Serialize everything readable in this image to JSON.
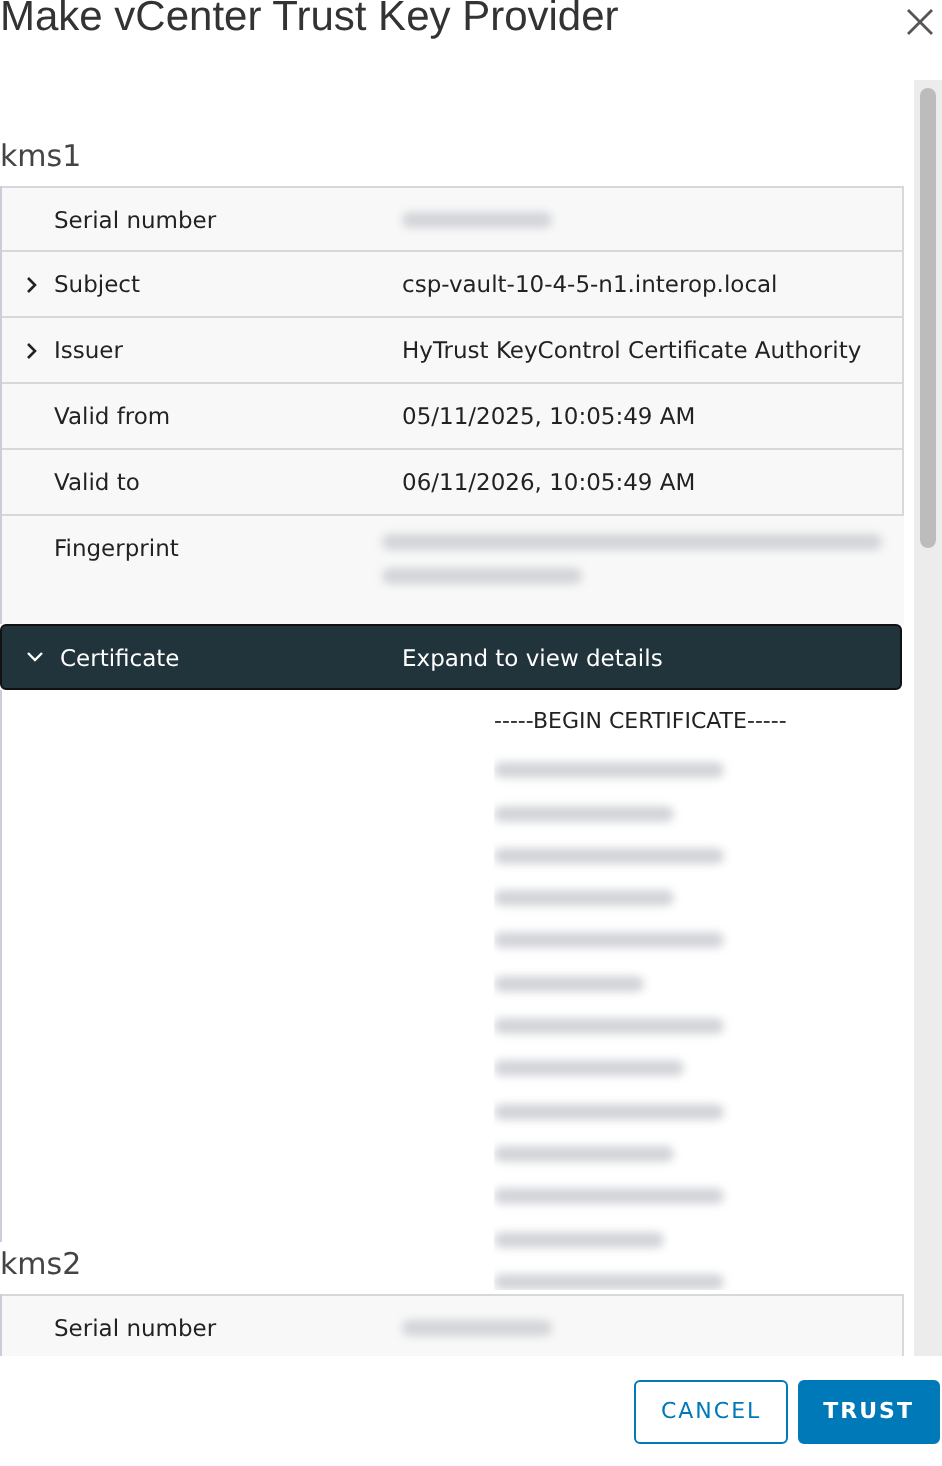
{
  "dialog": {
    "title": "Make vCenter Trust Key Provider"
  },
  "providers": [
    {
      "name": "kms1",
      "fields": [
        {
          "label": "Serial number",
          "expandable": false,
          "redacted": true
        },
        {
          "label": "Subject",
          "expandable": true,
          "redacted": false,
          "value": "csp-vault-10-4-5-n1.interop.local"
        },
        {
          "label": "Issuer",
          "expandable": true,
          "redacted": false,
          "value": "HyTrust KeyControl Certificate Authority"
        },
        {
          "label": "Valid from",
          "expandable": false,
          "redacted": false,
          "value": "05/11/2025, 10:05:49 AM"
        },
        {
          "label": "Valid to",
          "expandable": false,
          "redacted": false,
          "value": "06/11/2026, 10:05:49 AM"
        }
      ],
      "fingerprint": {
        "label": "Fingerprint",
        "redacted": true
      },
      "certificate": {
        "label": "Certificate",
        "value": "Expand to view details",
        "expanded": true,
        "header": "-----BEGIN CERTIFICATE-----"
      }
    },
    {
      "name": "kms2",
      "fields": [
        {
          "label": "Serial number",
          "expandable": false,
          "redacted": true
        }
      ]
    }
  ],
  "buttons": [
    {
      "label": "CANCEL",
      "kind": "secondary"
    },
    {
      "label": "TRUST",
      "kind": "primary"
    }
  ]
}
